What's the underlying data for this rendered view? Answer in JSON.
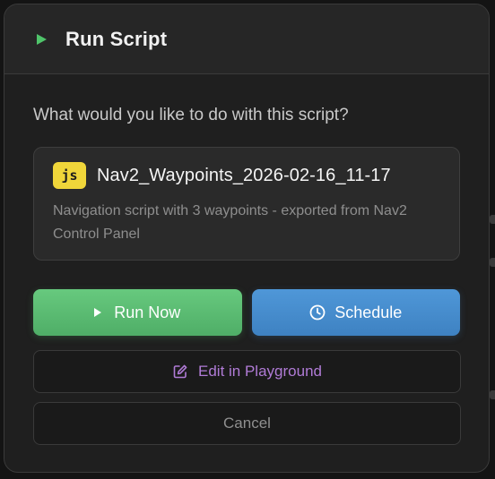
{
  "dialog": {
    "title": "Run Script",
    "prompt": "What would you like to do with this script?",
    "script": {
      "badge": "js",
      "name": "Nav2_Waypoints_2026-02-16_11-17",
      "description": "Navigation script with 3 waypoints - exported from Nav2 Control Panel"
    },
    "actions": {
      "run_now": "Run Now",
      "schedule": "Schedule",
      "edit": "Edit in Playground",
      "cancel": "Cancel"
    }
  },
  "colors": {
    "accent_green": "#5cbd74",
    "accent_blue": "#4a90d0",
    "accent_purple": "#b07bd6",
    "badge_yellow": "#f0d63a"
  },
  "icons": {
    "title": "play-icon",
    "run_now": "play-icon",
    "schedule": "clock-icon",
    "edit": "edit-icon"
  }
}
